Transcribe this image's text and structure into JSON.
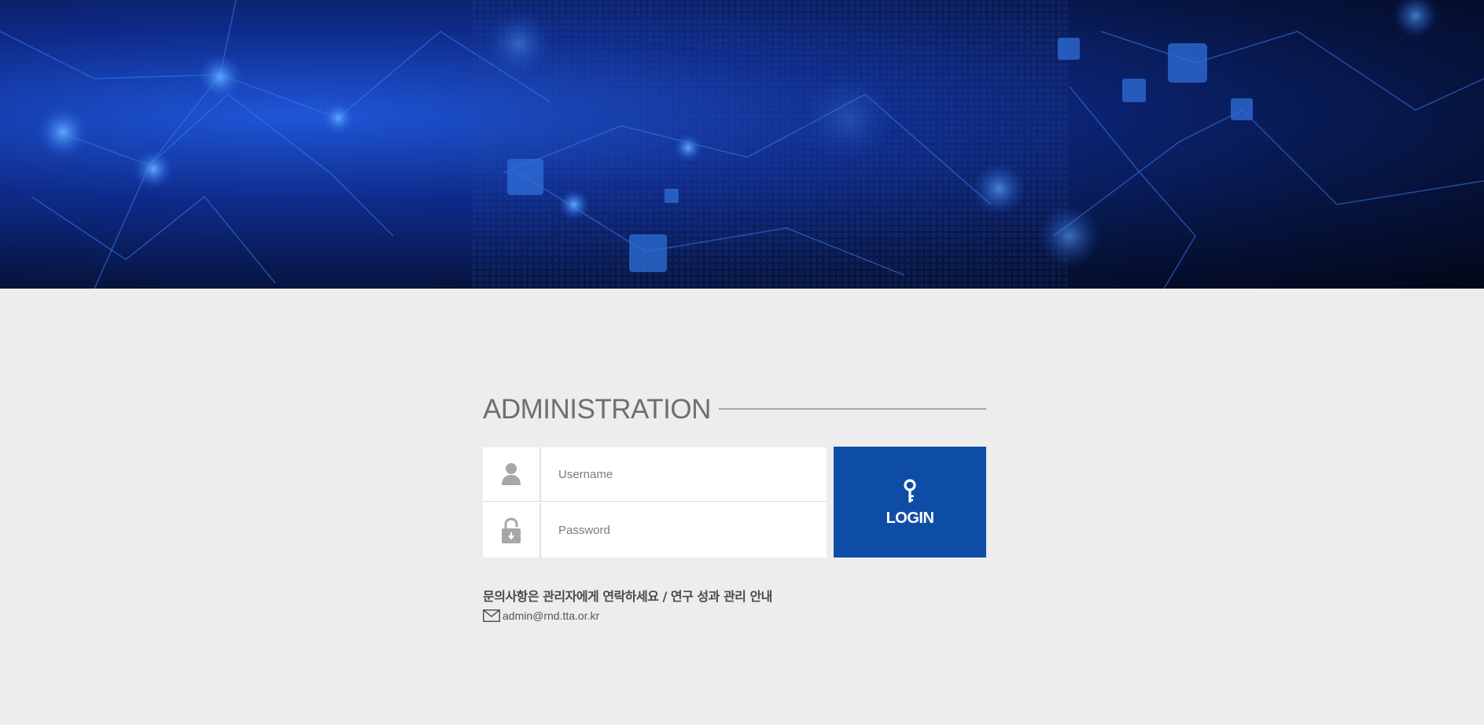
{
  "login": {
    "title": "ADMINISTRATION",
    "username_placeholder": "Username",
    "password_placeholder": "Password",
    "button_label": "LOGIN"
  },
  "footer": {
    "notice": "문의사항은 관리자에게 연락하세요 / 연구 성과 관리 안내",
    "email": "admin@rnd.tta.or.kr"
  },
  "icons": {
    "username": "user-icon",
    "password": "lock-icon",
    "login": "key-icon",
    "contact": "envelope-icon"
  },
  "colors": {
    "page_background": "#ededed",
    "login_button": "#0e4da5",
    "title_text": "#6f6f6f",
    "hero_primary": "#1f56d8",
    "hero_dark": "#061440"
  }
}
